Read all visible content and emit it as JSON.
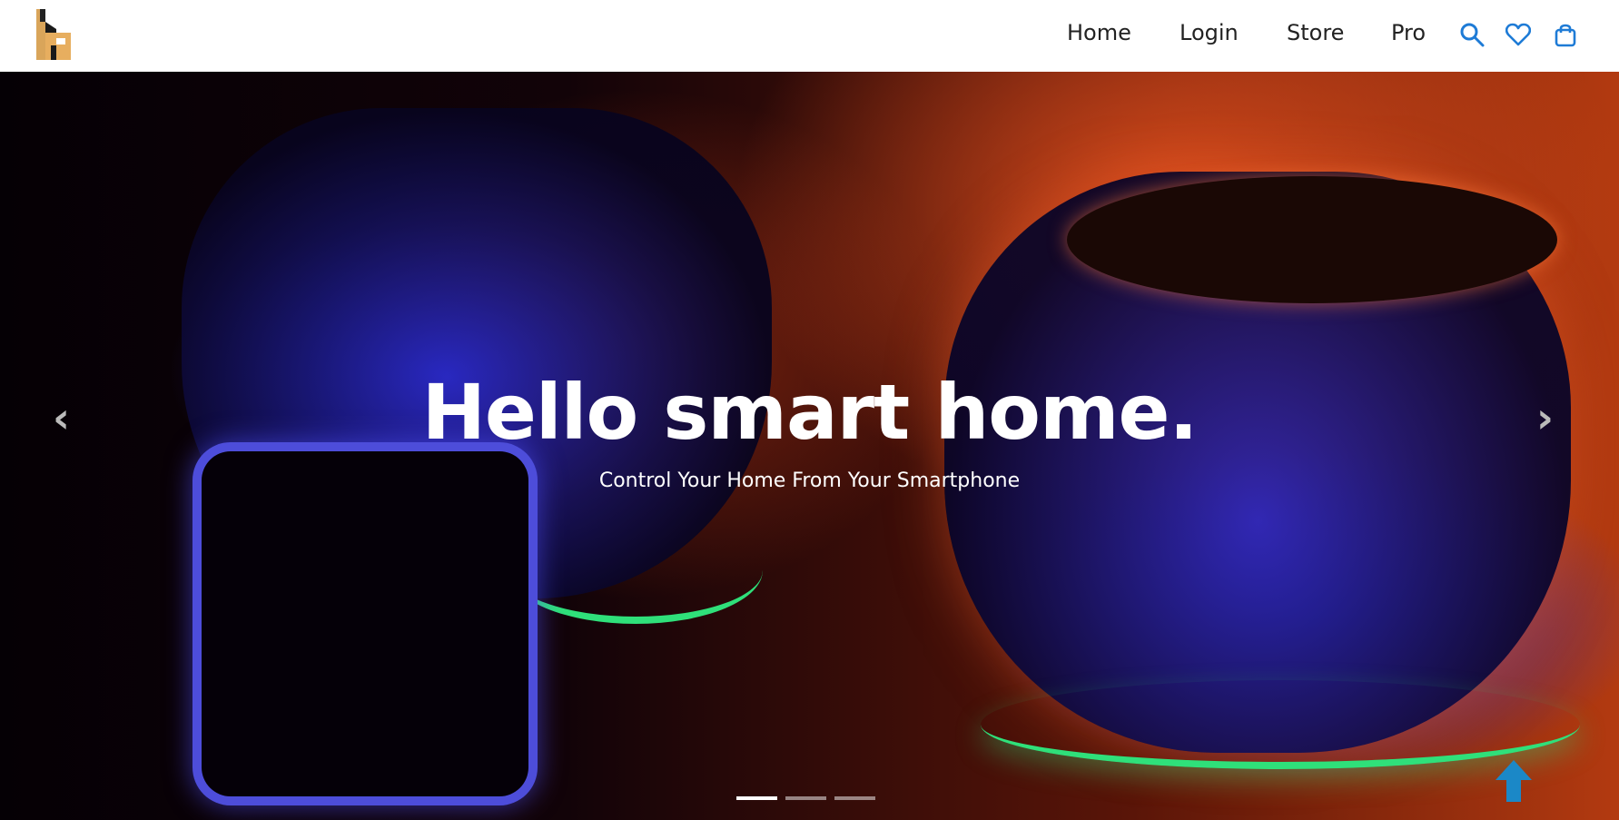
{
  "nav": {
    "links": [
      "Home",
      "Login",
      "Store",
      "Pro"
    ],
    "icons": [
      "search-icon",
      "heart-icon",
      "shopping-bag-icon"
    ],
    "icon_color": "#1e7bd6"
  },
  "hero": {
    "title": "Hello smart home.",
    "subtitle": "Control Your Home From Your Smartphone",
    "slides_total": 3,
    "active_slide": 1
  },
  "colors": {
    "accent": "#1e7bd6",
    "glow_green": "#2fe07a",
    "back_to_top": "#1b88c7"
  }
}
